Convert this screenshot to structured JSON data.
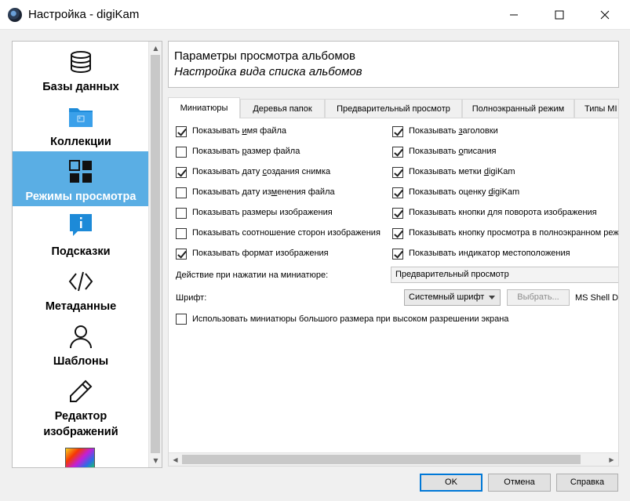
{
  "window": {
    "title": "Настройка - digiKam",
    "controls": {
      "minimize": "minimize-icon",
      "maximize": "maximize-icon",
      "close": "close-icon"
    }
  },
  "sidebar": {
    "items": [
      {
        "label": "Базы данных",
        "icon": "database-icon",
        "selected": false
      },
      {
        "label": "Коллекции",
        "icon": "folder-icon",
        "selected": false
      },
      {
        "label": "Режимы просмотра",
        "icon": "view-grid-icon",
        "selected": true
      },
      {
        "label": "Подсказки",
        "icon": "tooltip-icon",
        "selected": false
      },
      {
        "label": "Метаданные",
        "icon": "code-icon",
        "selected": false
      },
      {
        "label": "Шаблоны",
        "icon": "user-icon",
        "selected": false
      },
      {
        "label": "Редактор изображений",
        "line1": "Редактор",
        "line2": "изображений",
        "icon": "pencil-icon",
        "selected": false
      }
    ]
  },
  "header": {
    "title": "Параметры просмотра альбомов",
    "subtitle": "Настройка вида списка альбомов"
  },
  "tabs": [
    {
      "label": "Миниатюры",
      "active": true
    },
    {
      "label": "Деревья папок",
      "active": false
    },
    {
      "label": "Предварительный просмотр",
      "active": false
    },
    {
      "label": "Полноэкранный режим",
      "active": false
    },
    {
      "label": "Типы MI",
      "active": false
    }
  ],
  "options_left": [
    {
      "pre": "Показывать ",
      "u": "и",
      "post": "мя файла",
      "checked": true
    },
    {
      "pre": "Показывать ",
      "u": "р",
      "post": "азмер файла",
      "checked": false
    },
    {
      "pre": "Показывать дату ",
      "u": "с",
      "post": "оздания снимка",
      "checked": true
    },
    {
      "pre": "Показывать дату из",
      "u": "м",
      "post": "енения файла",
      "checked": false
    },
    {
      "pre": "Показывать размеры изображения",
      "u": "",
      "post": "",
      "checked": false
    },
    {
      "pre": "Показывать соотношение сторон изображения",
      "u": "",
      "post": "",
      "checked": false
    },
    {
      "pre": "Показывать формат изображения",
      "u": "",
      "post": "",
      "checked": true
    }
  ],
  "options_right": [
    {
      "pre": "Показывать ",
      "u": "з",
      "post": "аголовки",
      "checked": true
    },
    {
      "pre": "Показывать ",
      "u": "о",
      "post": "писания",
      "checked": true
    },
    {
      "pre": "Показывать метки ",
      "u": "d",
      "post": "igiKam",
      "checked": true
    },
    {
      "pre": "Показывать оценку ",
      "u": "d",
      "post": "igiKam",
      "checked": true
    },
    {
      "pre": "Показывать кнопки для поворота изображения",
      "u": "",
      "post": "",
      "checked": true
    },
    {
      "pre": "Показывать кнопку просмотра в полноэкранном реж",
      "u": "",
      "post": "",
      "checked": true
    },
    {
      "pre": "Показывать индикатор местоположения",
      "u": "",
      "post": "",
      "checked": true
    }
  ],
  "click_action": {
    "label": "Действие при нажатии на миниатюре:",
    "value": "Предварительный просмотр"
  },
  "font": {
    "label": "Шрифт:",
    "value": "Системный шрифт",
    "choose_button": "Выбрать...",
    "font_name": "MS Shell Dlg"
  },
  "large_thumbs": {
    "label": "Использовать миниатюры большого размера при высоком разрешении экрана",
    "checked": false
  },
  "buttons": {
    "ok": "OK",
    "cancel": "Отмена",
    "help": "Справка"
  }
}
